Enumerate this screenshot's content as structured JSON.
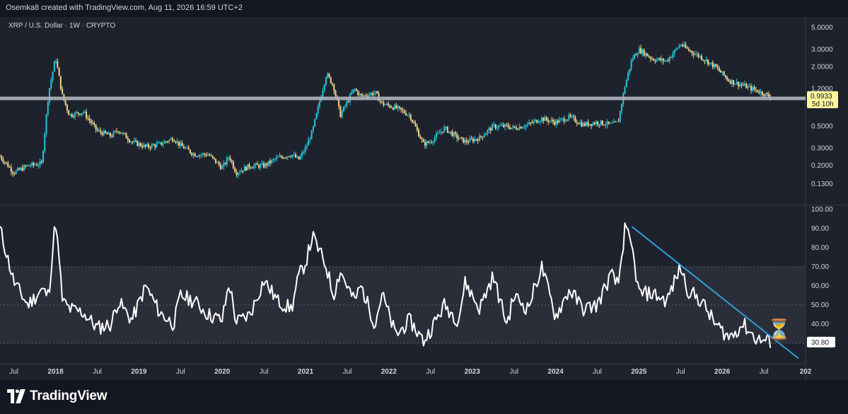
{
  "header": {
    "attribution": "Osemka8 created with TradingView.com, Aug 11, 2026 16:59 UTC+2"
  },
  "footer": {
    "brand": "TradingView"
  },
  "colors": {
    "background": "#1e222d",
    "bars": "#131722",
    "up": "#26c6da",
    "down": "#f0d58c",
    "rsi": "#ffffff",
    "trendline": "#2e9fd8",
    "hline": "#b2b5be",
    "price_label": "#fff59d"
  },
  "chart_data": [
    {
      "type": "candlestick",
      "title": "XRP / U.S. Dollar · 1W · CRYPTO",
      "yscale": "log",
      "ylim": [
        0.085,
        5.6
      ],
      "yticks": [
        "5.0000",
        "3.0000",
        "2.0000",
        "1.2000",
        "0.5000",
        "0.3000",
        "0.2000",
        "0.1300"
      ],
      "ytick_values": [
        5.0,
        3.0,
        2.0,
        1.2,
        0.5,
        0.3,
        0.2,
        0.13
      ],
      "horizontal_line": 0.96,
      "last_price": "0.9933",
      "countdown": "5d 10h",
      "xlim": [
        "2017-05-01",
        "2027-01-01"
      ],
      "x": [
        "2017-05",
        "2017-07",
        "2017-09",
        "2017-11",
        "2017-12",
        "2018-01",
        "2018-02",
        "2018-03",
        "2018-05",
        "2018-07",
        "2018-09",
        "2018-10",
        "2018-12",
        "2019-02",
        "2019-04",
        "2019-06",
        "2019-07",
        "2019-09",
        "2019-11",
        "2020-01",
        "2020-02",
        "2020-03",
        "2020-05",
        "2020-07",
        "2020-09",
        "2020-11",
        "2020-12",
        "2021-01",
        "2021-02",
        "2021-04",
        "2021-05",
        "2021-06",
        "2021-08",
        "2021-09",
        "2021-11",
        "2021-12",
        "2022-02",
        "2022-04",
        "2022-06",
        "2022-07",
        "2022-09",
        "2022-11",
        "2022-12",
        "2023-02",
        "2023-04",
        "2023-06",
        "2023-07",
        "2023-09",
        "2023-11",
        "2024-01",
        "2024-03",
        "2024-05",
        "2024-07",
        "2024-09",
        "2024-10",
        "2024-11",
        "2024-12",
        "2025-01",
        "2025-03",
        "2025-05",
        "2025-07",
        "2025-08",
        "2025-10",
        "2025-12",
        "2026-02",
        "2026-04",
        "2026-06",
        "2026-08"
      ],
      "close": [
        0.25,
        0.17,
        0.2,
        0.21,
        1.1,
        2.5,
        1.0,
        0.65,
        0.7,
        0.45,
        0.4,
        0.46,
        0.35,
        0.31,
        0.33,
        0.38,
        0.32,
        0.26,
        0.26,
        0.19,
        0.25,
        0.17,
        0.2,
        0.2,
        0.24,
        0.26,
        0.23,
        0.3,
        0.45,
        1.7,
        1.3,
        0.65,
        1.2,
        1.0,
        1.1,
        0.85,
        0.77,
        0.65,
        0.33,
        0.35,
        0.48,
        0.38,
        0.35,
        0.38,
        0.5,
        0.5,
        0.48,
        0.52,
        0.6,
        0.55,
        0.62,
        0.52,
        0.55,
        0.52,
        0.55,
        1.3,
        2.4,
        3.0,
        2.4,
        2.3,
        3.4,
        3.0,
        2.5,
        2.0,
        1.45,
        1.3,
        1.15,
        0.99
      ]
    },
    {
      "type": "line",
      "title": "",
      "ylim": [
        20,
        100
      ],
      "yticks": [
        "100.00",
        "90.00",
        "80.00",
        "70.00",
        "60.00",
        "50.00",
        "40.00",
        "30.00"
      ],
      "ytick_values": [
        100,
        90,
        80,
        70,
        60,
        50,
        40,
        30
      ],
      "band": [
        30,
        70
      ],
      "midline": 50,
      "last_value": "30.80",
      "xlim": [
        "2017-05-01",
        "2027-01-01"
      ],
      "x": [
        "2017-05",
        "2017-07",
        "2017-09",
        "2017-11",
        "2017-12",
        "2018-01",
        "2018-02",
        "2018-03",
        "2018-05",
        "2018-07",
        "2018-09",
        "2018-10",
        "2018-12",
        "2019-02",
        "2019-04",
        "2019-06",
        "2019-07",
        "2019-09",
        "2019-11",
        "2020-01",
        "2020-02",
        "2020-03",
        "2020-05",
        "2020-07",
        "2020-09",
        "2020-11",
        "2020-12",
        "2021-01",
        "2021-02",
        "2021-04",
        "2021-05",
        "2021-06",
        "2021-08",
        "2021-09",
        "2021-11",
        "2021-12",
        "2022-02",
        "2022-04",
        "2022-06",
        "2022-07",
        "2022-09",
        "2022-11",
        "2022-12",
        "2023-02",
        "2023-04",
        "2023-06",
        "2023-07",
        "2023-09",
        "2023-11",
        "2024-01",
        "2024-03",
        "2024-05",
        "2024-07",
        "2024-09",
        "2024-10",
        "2024-11",
        "2024-12",
        "2025-01",
        "2025-03",
        "2025-05",
        "2025-07",
        "2025-08",
        "2025-10",
        "2025-12",
        "2026-02",
        "2026-04",
        "2026-06",
        "2026-08"
      ],
      "values": [
        90,
        62,
        50,
        58,
        55,
        95,
        52,
        48,
        46,
        38,
        40,
        52,
        42,
        60,
        46,
        40,
        55,
        52,
        45,
        42,
        62,
        41,
        45,
        63,
        52,
        48,
        65,
        72,
        86,
        70,
        55,
        68,
        52,
        60,
        40,
        56,
        34,
        42,
        31,
        37,
        50,
        42,
        62,
        48,
        65,
        40,
        55,
        48,
        70,
        44,
        58,
        48,
        50,
        66,
        60,
        90,
        80,
        56,
        56,
        52,
        70,
        58,
        52,
        40,
        33,
        40,
        32,
        30.8
      ],
      "trendline": {
        "from": [
          "2024-12",
          91
        ],
        "to": [
          "2026-12",
          22
        ]
      },
      "annotation": "⏳"
    }
  ],
  "xaxis": {
    "ticks": [
      "Jul",
      "2018",
      "Jul",
      "2019",
      "Jul",
      "2020",
      "Jul",
      "2021",
      "Jul",
      "2022",
      "Jul",
      "2023",
      "Jul",
      "2024",
      "Jul",
      "2025",
      "Jul",
      "2026",
      "Jul",
      "202"
    ]
  }
}
